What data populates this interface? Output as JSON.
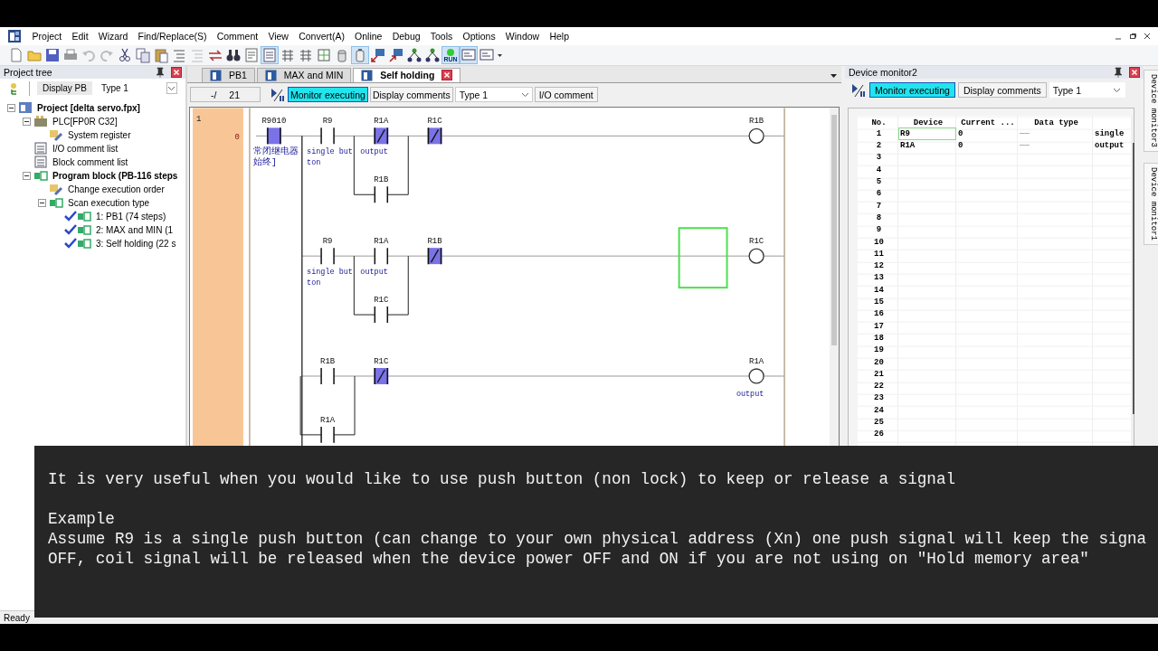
{
  "menu": [
    "Project",
    "Edit",
    "Wizard",
    "Find/Replace(S)",
    "Comment",
    "View",
    "Convert(A)",
    "Online",
    "Debug",
    "Tools",
    "Options",
    "Window",
    "Help"
  ],
  "toolbar": [
    {
      "pressed": false
    },
    {
      "pressed": false
    },
    {
      "pressed": false
    },
    {
      "pressed": false
    },
    {
      "pressed": false
    },
    {
      "pressed": false
    },
    {
      "pressed": false
    },
    {
      "pressed": false
    },
    {
      "pressed": false
    },
    {
      "pressed": false
    },
    {
      "pressed": false
    },
    {
      "pressed": false
    },
    {
      "pressed": false
    },
    {
      "pressed": false
    },
    {
      "pressed": true
    },
    {
      "pressed": false
    },
    {
      "pressed": false
    },
    {
      "pressed": false
    },
    {
      "pressed": false
    },
    {
      "pressed": true
    },
    {
      "pressed": false
    },
    {
      "pressed": false
    },
    {
      "pressed": false
    },
    {
      "pressed": false
    },
    {
      "pressed": true,
      "label": "RUN"
    },
    {
      "pressed": true
    },
    {
      "pressed": false
    }
  ],
  "project_tree": {
    "title": "Project tree",
    "button": "Display PB",
    "dropdown": "Type 1",
    "items": [
      {
        "label": "Project [delta servo.fpx]",
        "kind": "project",
        "bold": true,
        "expanded": true,
        "children": [
          {
            "label": "PLC[FP0R C32]",
            "kind": "plc",
            "expanded": true,
            "children": [
              {
                "label": "System register",
                "kind": "settings"
              }
            ]
          },
          {
            "label": "I/O comment list",
            "kind": "list"
          },
          {
            "label": "Block comment list",
            "kind": "list"
          },
          {
            "label": "Program block (PB-116 steps",
            "kind": "program",
            "bold": true,
            "expanded": true,
            "children": [
              {
                "label": "Change execution order",
                "kind": "settings"
              },
              {
                "label": "Scan execution type",
                "kind": "program",
                "expanded": true,
                "children": [
                  {
                    "label": "1: PB1 (74 steps)",
                    "kind": "program",
                    "checked": true
                  },
                  {
                    "label": "2: MAX and MIN (1",
                    "kind": "program",
                    "checked": true
                  },
                  {
                    "label": "3: Self holding (22 s",
                    "kind": "program",
                    "checked": true
                  }
                ]
              }
            ]
          }
        ]
      }
    ]
  },
  "editor": {
    "tabs": [
      {
        "label": "PB1",
        "selected": false
      },
      {
        "label": "MAX and MIN",
        "selected": false
      },
      {
        "label": "Self holding",
        "selected": true
      }
    ],
    "address": "-/",
    "steps": "21",
    "buttons": [
      {
        "label": "Monitor executing",
        "on": true
      },
      {
        "label": "Display comments",
        "on": false
      }
    ],
    "dropdown": "Type 1",
    "io_comment": "I/O comment",
    "ladder": {
      "block": "1",
      "rungs": [
        {
          "step": "0",
          "cells": [
            {
              "kind": "contact_no",
              "device": "R9010",
              "comment": [
                "常闭继电器",
                "始终]"
              ],
              "active": true
            },
            {
              "kind": "contact_no",
              "device": "R9",
              "comment": [
                "single but",
                "ton"
              ],
              "active": false
            },
            {
              "kind": "contact_nc",
              "device": "R1A",
              "comment": [
                "output"
              ],
              "active": true,
              "parallel": {
                "kind": "contact_no",
                "device": "R1B",
                "active": false
              }
            },
            {
              "kind": "contact_nc",
              "device": "R1C",
              "active": true
            }
          ],
          "coil": {
            "device": "R1B"
          }
        },
        {
          "cells": [
            {
              "kind": "empty"
            },
            {
              "kind": "contact_no",
              "device": "R9",
              "comment": [
                "single but",
                "ton"
              ],
              "active": false
            },
            {
              "kind": "contact_no",
              "device": "R1A",
              "comment": [
                "output"
              ],
              "active": false,
              "parallel": {
                "kind": "contact_no",
                "device": "R1C",
                "active": false
              }
            },
            {
              "kind": "contact_nc",
              "device": "R1B",
              "active": true
            },
            {
              "kind": "wire"
            },
            {
              "kind": "wire"
            },
            {
              "kind": "wire"
            },
            {
              "kind": "wire"
            },
            {
              "kind": "cursor"
            }
          ],
          "coil": {
            "device": "R1C"
          }
        },
        {
          "cells": [
            {
              "kind": "empty"
            },
            {
              "kind": "contact_no",
              "device": "R1B",
              "active": false,
              "parallel": {
                "kind": "contact_no",
                "device": "R1A",
                "active": false
              }
            },
            {
              "kind": "contact_nc",
              "device": "R1C",
              "active": true
            }
          ],
          "coil": {
            "device": "R1A",
            "comment": [
              "output"
            ]
          }
        }
      ]
    }
  },
  "device_monitor": {
    "title": "Device monitor2",
    "buttons": [
      {
        "label": "Monitor executing",
        "on": true
      },
      {
        "label": "Display comments",
        "on": false
      }
    ],
    "dropdown": "Type 1",
    "columns": [
      "No.",
      "Device",
      "Current ...",
      "Data type"
    ],
    "rows": [
      {
        "no": "1",
        "device": "R9",
        "current": "0",
        "data_type": "——",
        "comment": "single",
        "selected": true
      },
      {
        "no": "2",
        "device": "R1A",
        "current": "0",
        "data_type": "——",
        "comment": "output",
        "selected": false
      },
      {
        "no": "3",
        "selected": false
      },
      {
        "no": "4",
        "selected": false
      },
      {
        "no": "5",
        "selected": false
      },
      {
        "no": "6",
        "selected": false
      },
      {
        "no": "7",
        "selected": false
      },
      {
        "no": "8",
        "selected": false
      },
      {
        "no": "9",
        "selected": false
      },
      {
        "no": "10",
        "selected": false
      },
      {
        "no": "11",
        "selected": false
      },
      {
        "no": "12",
        "selected": false
      },
      {
        "no": "13",
        "selected": false
      },
      {
        "no": "14",
        "selected": false
      },
      {
        "no": "15",
        "selected": false
      },
      {
        "no": "16",
        "selected": false
      },
      {
        "no": "17",
        "selected": false
      },
      {
        "no": "18",
        "selected": false
      },
      {
        "no": "19",
        "selected": false
      },
      {
        "no": "20",
        "selected": false
      },
      {
        "no": "21",
        "selected": false
      },
      {
        "no": "22",
        "selected": false
      },
      {
        "no": "23",
        "selected": false
      },
      {
        "no": "24",
        "selected": false
      },
      {
        "no": "25",
        "selected": false
      },
      {
        "no": "26",
        "selected": false
      }
    ]
  },
  "side_tabs": [
    "Device monitor3",
    "Device monitor1"
  ],
  "status_bar": "Ready",
  "caption": [
    [
      "It is very useful when you would like to use push button (non lock) to keep or release a signal"
    ],
    [
      "Example",
      "Assume R9 is a single push button (can change to your own physical address (Xn) one push signal will keep the signa",
      "OFF, coil signal will be released when the device power OFF and ON if you are not using on \"Hold memory area\""
    ]
  ]
}
